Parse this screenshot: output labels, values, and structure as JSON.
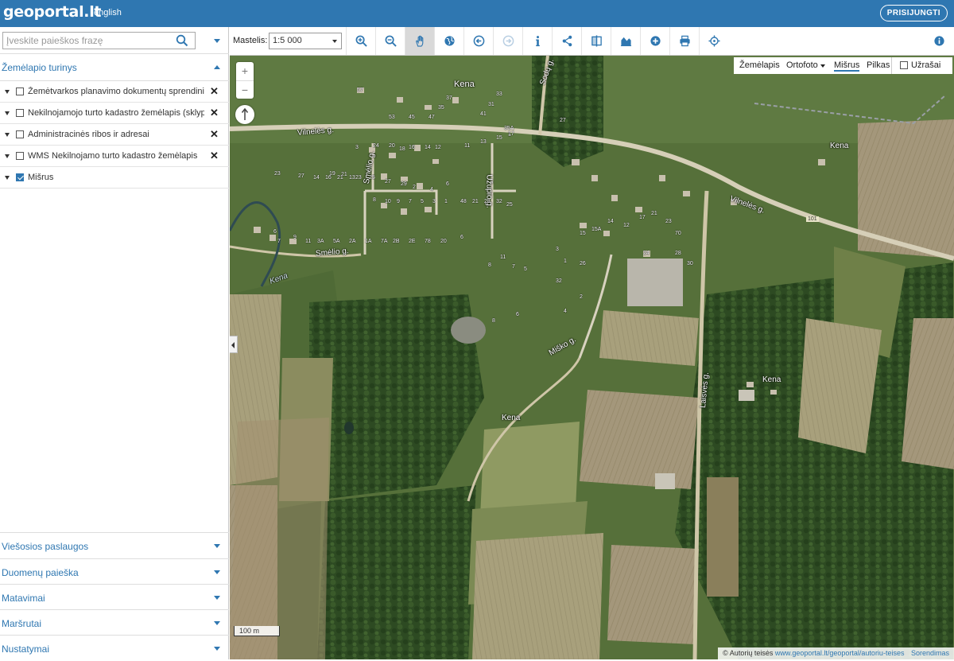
{
  "header": {
    "logo": "geoportal.lt",
    "language": "english",
    "login_label": "PRISIJUNGTI"
  },
  "sidebar": {
    "search_placeholder": "Įveskite paieškos frazę",
    "layers_title": "Žemėlapio turinys",
    "layers": [
      {
        "label": "Žemėtvarkos planavimo dokumentų sprendiniai",
        "checked": false
      },
      {
        "label": "Nekilnojamojo turto kadastro žemėlapis (sklypai)",
        "checked": false
      },
      {
        "label": "Administracinės ribos ir adresai",
        "checked": false
      },
      {
        "label": "WMS Nekilnojamo turto kadastro žemėlapis",
        "checked": false
      },
      {
        "label": "Mišrus",
        "checked": true
      }
    ],
    "sections": [
      "Viešosios paslaugos",
      "Duomenų paieška",
      "Matavimai",
      "Maršrutai",
      "Nustatymai"
    ]
  },
  "toolbar": {
    "scale_label": "Mastelis:",
    "scale_value": "1:5 000",
    "tools": [
      "zoom-in-icon",
      "zoom-out-icon",
      "pan-hand-icon",
      "globe-icon",
      "previous-extent-icon",
      "next-extent-icon",
      "info-icon",
      "share-icon",
      "compare-icon",
      "profile-icon",
      "add-icon",
      "print-icon",
      "locate-icon"
    ],
    "active_tool": "pan-hand-icon"
  },
  "map": {
    "basemaps": {
      "zemelapis": "Žemėlapis",
      "ortofoto": "Ortofoto",
      "misrus": "Mišrus",
      "pilkas": "Pilkas",
      "uzrasai": "Užrašai"
    },
    "selected_basemap": "Mišrus",
    "labels": {
      "kena1": "Kena",
      "kena2": "Kena",
      "kena3": "Kena",
      "kena4": "Kena",
      "kena_river": "Kena",
      "vilneles1": "Vilnelės g.",
      "vilneles2": "Vilnelės g.",
      "smelio1": "Smėlio g.",
      "smelio2": "Smėlio g.",
      "uzupio": "Užupio g.",
      "misko": "Miško g.",
      "laisves": "Laisvės g.",
      "sodu": "Sodų g.",
      "road_number": "101"
    },
    "house_numbers": [
      "57",
      "53",
      "45",
      "47",
      "35",
      "37",
      "41",
      "31",
      "33",
      "35A",
      "27",
      "1",
      "3",
      "24",
      "20",
      "18",
      "16",
      "14",
      "12",
      "11",
      "13",
      "15",
      "17",
      "19",
      "21",
      "23",
      "25",
      "27",
      "29",
      "2",
      "4",
      "6",
      "8",
      "10",
      "9",
      "7",
      "5",
      "3",
      "1",
      "48",
      "21",
      "28",
      "32",
      "25",
      "23",
      "27",
      "14",
      "16",
      "21",
      "13",
      "6",
      "7",
      "9",
      "11",
      "3A",
      "5A",
      "2A",
      "1A",
      "7A",
      "2B",
      "2E",
      "78",
      "20",
      "6",
      "8",
      "11",
      "7",
      "5",
      "3",
      "1",
      "15",
      "15A",
      "14",
      "12",
      "17",
      "21",
      "23",
      "70",
      "24",
      "26",
      "28",
      "30",
      "32",
      "2",
      "4",
      "6",
      "8"
    ],
    "scale_bar": "100 m",
    "attribution_prefix": "© Autorių teisės",
    "attribution_link": "www.geoportal.lt/geoportal/autoriu-teises",
    "attribution_suffix": "Sorendimas"
  },
  "colors": {
    "brand": "#2f77b1"
  }
}
